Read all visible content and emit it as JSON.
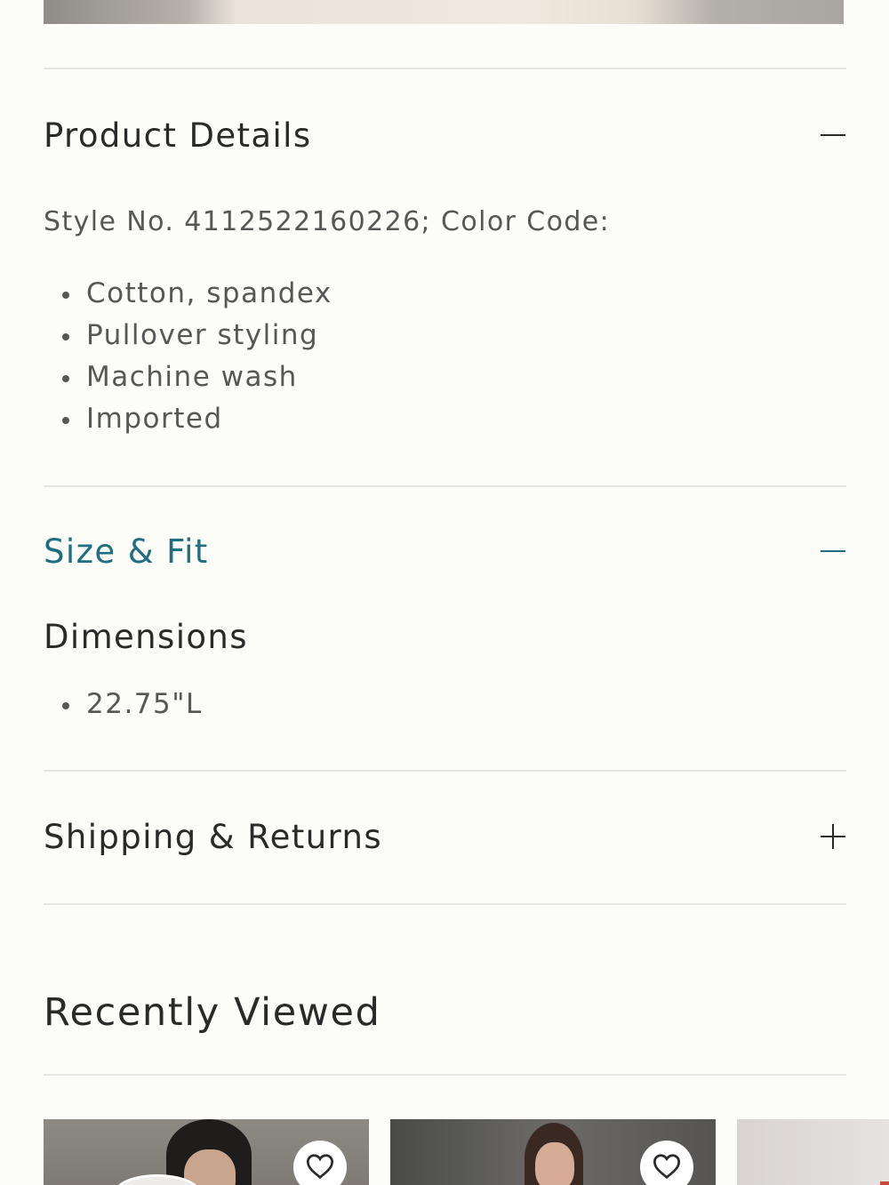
{
  "accordion": {
    "product_details": {
      "title": "Product Details",
      "expanded": true,
      "style_line": "Style No. 4112522160226; Color Code:",
      "bullets": [
        "Cotton, spandex",
        "Pullover styling",
        "Machine wash",
        "Imported"
      ]
    },
    "size_fit": {
      "title": "Size & Fit",
      "expanded": true,
      "dimensions_title": "Dimensions",
      "bullets": [
        "22.75\"L"
      ]
    },
    "shipping_returns": {
      "title": "Shipping & Returns",
      "expanded": false
    }
  },
  "recently_viewed": {
    "title": "Recently Viewed",
    "cards": [
      {
        "favorite_icon": "heart-outline-icon"
      },
      {
        "favorite_icon": "heart-outline-icon"
      },
      {}
    ]
  },
  "colors": {
    "background": "#fcfcf9",
    "text": "#2a2a2a",
    "muted_text": "#575757",
    "accent": "#1f6f80",
    "divider": "#e6e6e2"
  }
}
